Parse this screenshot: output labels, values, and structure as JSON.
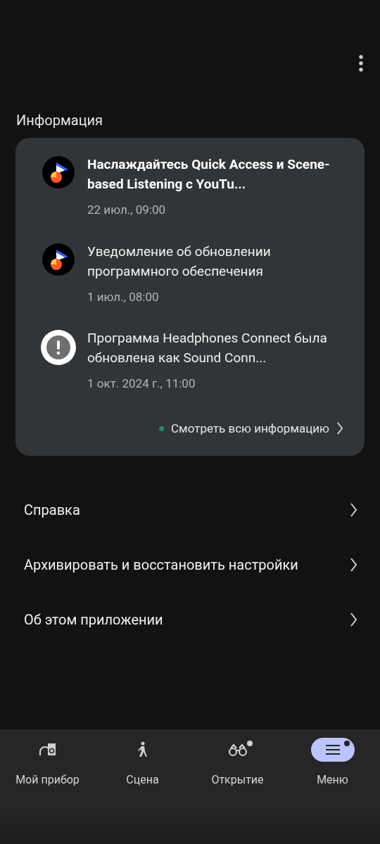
{
  "section_title": "Информация",
  "notifications": [
    {
      "kind": "app",
      "unread": true,
      "title": "Наслаждайтесь Quick Access и Scene-based Listening с YouTu...",
      "time": "22 июл., 09:00"
    },
    {
      "kind": "app",
      "unread": false,
      "title": "Уведомление об обновлении программного обеспечения",
      "time": "1 июл., 08:00"
    },
    {
      "kind": "alert",
      "unread": false,
      "title": "Программа Headphones Connect была обновлена как Sound Conn...",
      "time": "1 окт. 2024 г., 11:00"
    }
  ],
  "see_all": {
    "label": "Смотреть всю информацию",
    "new": true
  },
  "menu_items": [
    "Справка",
    "Архивировать и восстановить настройки",
    "Об этом приложении"
  ],
  "nav": [
    {
      "kind": "device",
      "label": "Мой прибор",
      "selected": false,
      "badge": false
    },
    {
      "kind": "scene",
      "label": "Сцена",
      "selected": false,
      "badge": false
    },
    {
      "kind": "discover",
      "label": "Открытие",
      "selected": false,
      "badge": true
    },
    {
      "kind": "menu",
      "label": "Меню",
      "selected": true,
      "badge": true
    }
  ]
}
